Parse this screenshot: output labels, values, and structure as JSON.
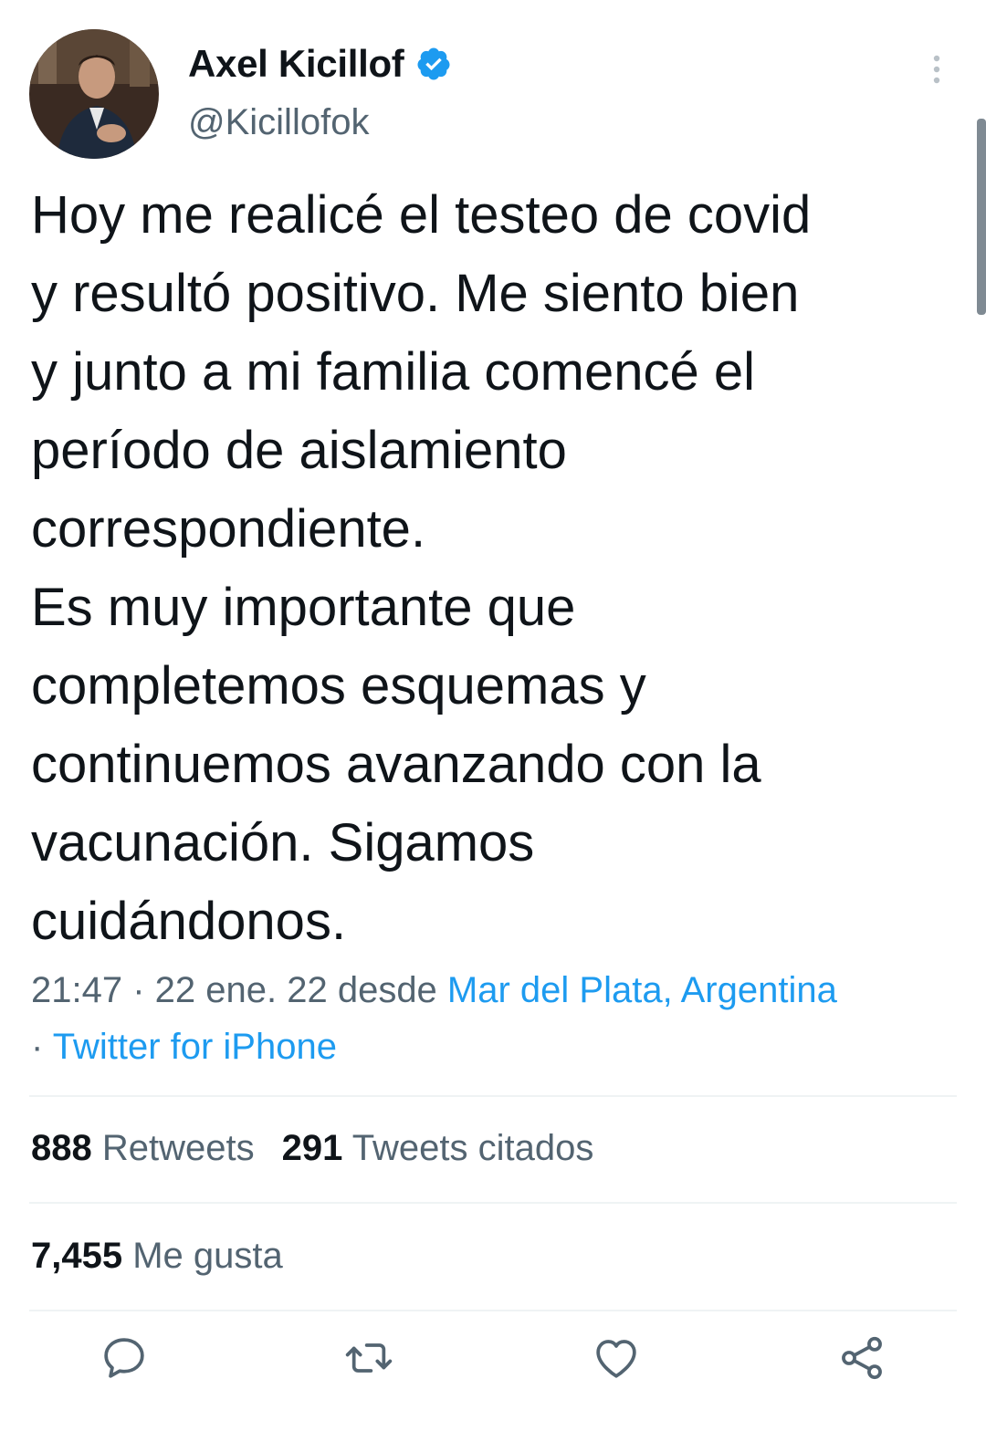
{
  "author": {
    "display_name": "Axel Kicillof",
    "handle": "@Kicillofok",
    "verified": true,
    "avatar_icon": "profile-photo"
  },
  "tweet": {
    "lines": [
      "Hoy me realicé el testeo de covid",
      "y resultó positivo. Me siento bien",
      "y junto a mi familia comencé el",
      "período de aislamiento",
      "correspondiente.",
      "Es muy importante que",
      "completemos esquemas y",
      "continuemos avanzando con la",
      "vacunación. Sigamos",
      "cuidándonos."
    ]
  },
  "meta": {
    "time_date": "21:47 · 22 ene. 22 desde ",
    "location": "Mar del Plata, Argentina",
    "separator": "· ",
    "source": "Twitter for iPhone"
  },
  "stats": {
    "retweets_count": "888",
    "retweets_label": "Retweets",
    "quotes_count": "291",
    "quotes_label": "Tweets citados",
    "likes_count": "7,455",
    "likes_label": "Me gusta"
  },
  "colors": {
    "accent": "#1d9bf0",
    "text": "#0f1419",
    "secondary": "#536471",
    "divider": "#eff3f4"
  },
  "icons": {
    "more": "more-vertical-icon",
    "reply": "reply-icon",
    "retweet": "retweet-icon",
    "like": "heart-icon",
    "share": "share-icon",
    "verified": "verified-badge-icon"
  }
}
